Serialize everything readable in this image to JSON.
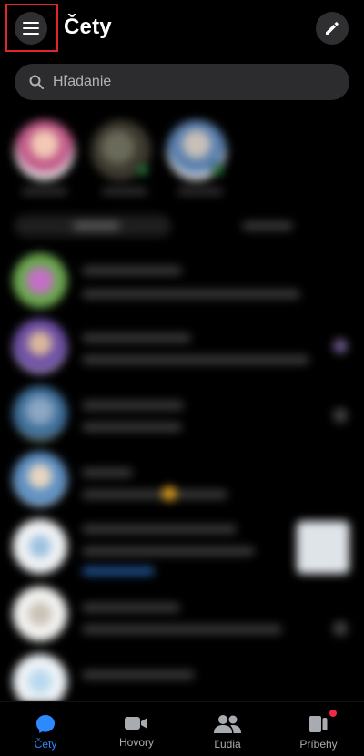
{
  "header": {
    "title": "Čety",
    "menu_icon": "menu-icon",
    "compose_icon": "pencil-icon"
  },
  "search": {
    "placeholder": "Hľadanie"
  },
  "tabs": [
    {
      "label": "Čety",
      "icon": "chat-bubble-icon",
      "active": true
    },
    {
      "label": "Hovory",
      "icon": "video-camera-icon",
      "active": false
    },
    {
      "label": "Ľudia",
      "icon": "people-icon",
      "active": false
    },
    {
      "label": "Príbehy",
      "icon": "stories-icon",
      "active": false,
      "badge": true
    }
  ],
  "colors": {
    "accent": "#2e89ff",
    "highlight": "#e0262a",
    "badge": "#f02849",
    "online": "#31a24c"
  }
}
